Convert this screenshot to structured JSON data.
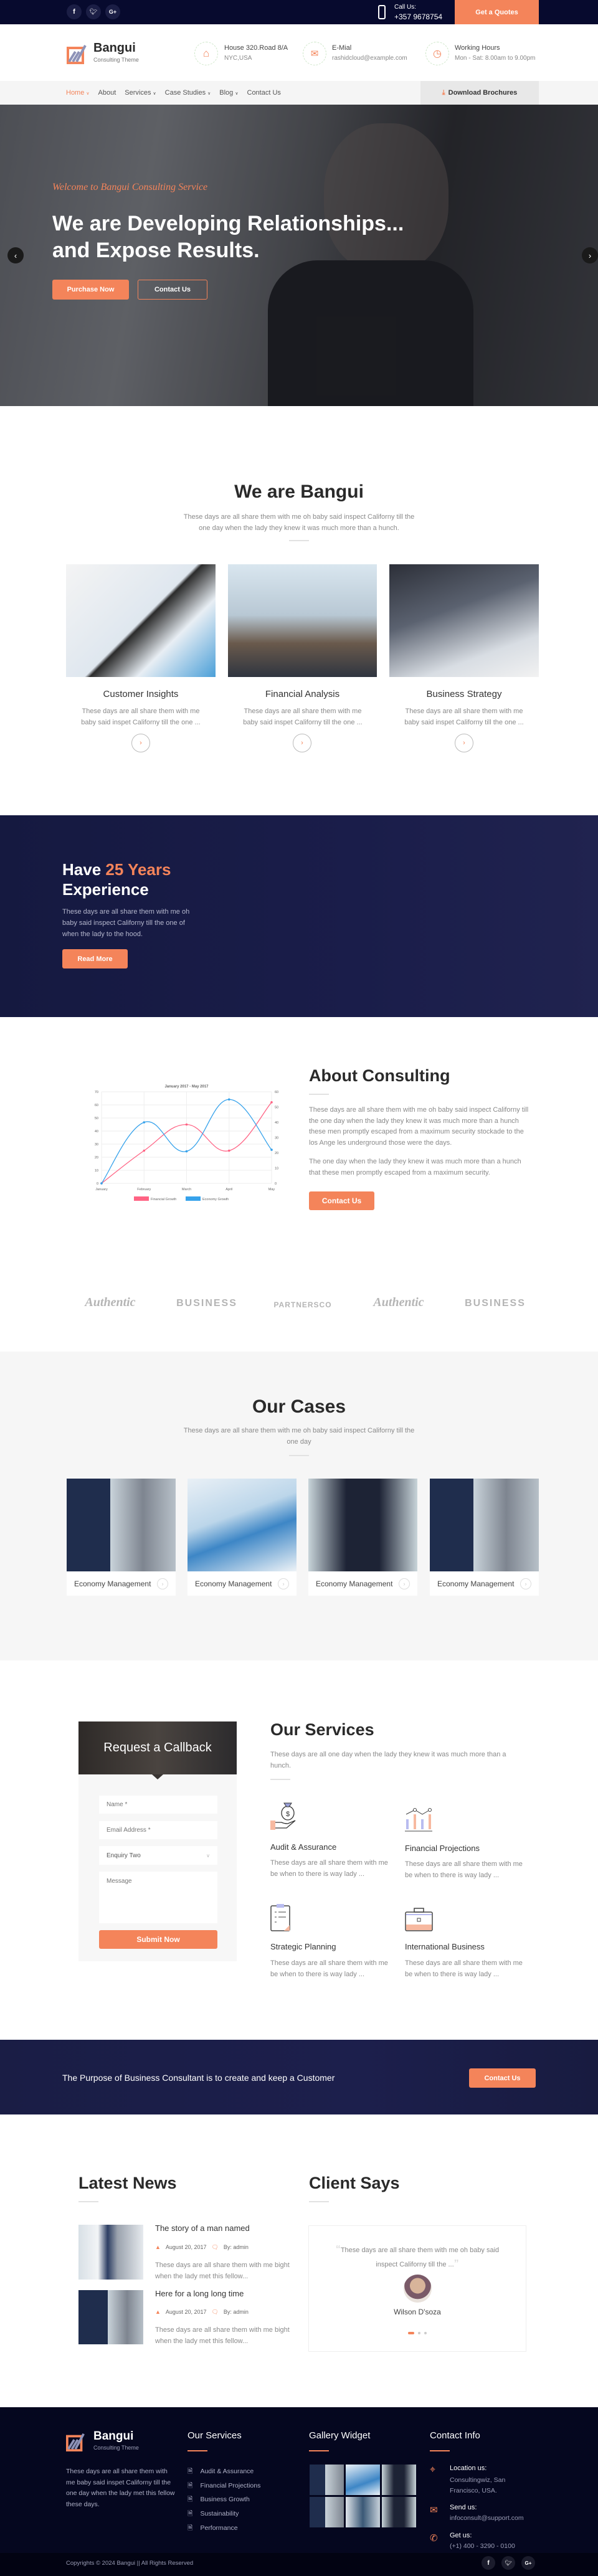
{
  "topbar": {
    "social": [
      "facebook-icon",
      "twitter-icon",
      "google-plus-icon"
    ],
    "call_label": "Call Us:",
    "call_number": "+357 9678754",
    "quote_button": "Get a Quotes"
  },
  "header": {
    "logo_name": "Bangui",
    "logo_tagline": "Consulting Theme",
    "info": [
      {
        "icon": "home-icon",
        "title": "House 320.Road 8/A",
        "text": "NYC,USA"
      },
      {
        "icon": "envelope-icon",
        "title": "E-Mial",
        "text": "rashidcloud@example.com"
      },
      {
        "icon": "clock-icon",
        "title": "Working Hours",
        "text": "Mon - Sat: 8.00am to 9.00pm"
      }
    ]
  },
  "nav": {
    "items": [
      {
        "label": "Home",
        "dropdown": true,
        "active": true
      },
      {
        "label": "About",
        "dropdown": false
      },
      {
        "label": "Services",
        "dropdown": true
      },
      {
        "label": "Case Studies",
        "dropdown": true
      },
      {
        "label": "Blog",
        "dropdown": true
      },
      {
        "label": "Contact Us",
        "dropdown": false
      }
    ],
    "download": "Download Brochures"
  },
  "hero": {
    "welcome": "Welcome to Bangui Consulting Service",
    "line1": "We are Developing Relationships...",
    "line2": "and Expose Results.",
    "purchase": "Purchase Now",
    "contact": "Contact Us"
  },
  "about_bangui": {
    "title": "We are Bangui",
    "subtitle": "These days are all share them with me oh baby said inspect Californy till the one day when the lady they knew it was much more than a hunch.",
    "cards": [
      {
        "title": "Customer Insights",
        "text": "These days are all share them with me baby said inspet Californy till the one ..."
      },
      {
        "title": "Financial Analysis",
        "text": "These days are all share them with me baby said inspet Californy till the one ..."
      },
      {
        "title": "Business Strategy",
        "text": "These days are all share them with me baby said inspet Californy till the one ..."
      }
    ]
  },
  "experience": {
    "have": "Have",
    "years": "25 Years",
    "experience": "Experience",
    "text": "These days are all share them with me oh baby said inspect Californy till the one of when the lady to the hood.",
    "button": "Read More"
  },
  "about_consulting": {
    "title": "About Consulting",
    "para1": "These days are all share them with me oh baby said inspect Californy till the one day when the lady they knew it was much more than a hunch these men promptly escaped from a maximum security stockade to the los Ange les underground those were the days.",
    "para2": "The one day when the lady they knew it was much more than a hunch that these men promptly escaped from a maximum security.",
    "button": "Contact Us"
  },
  "chart_data": {
    "type": "line",
    "title": "January 2017 - May 2017",
    "categories": [
      "January",
      "February",
      "March",
      "April",
      "May"
    ],
    "series": [
      {
        "name": "Financial Growth",
        "values": [
          0,
          25,
          45,
          25,
          62
        ],
        "axis": "left",
        "color": "#ff6384"
      },
      {
        "name": "Economy Growth",
        "values": [
          0,
          40,
          21,
          55,
          22
        ],
        "axis": "right",
        "color": "#36a2eb"
      }
    ],
    "ylim_left": [
      0,
      70
    ],
    "ylim_right": [
      0,
      60
    ],
    "yticks_left": [
      "0",
      "10",
      "20",
      "30",
      "40",
      "50",
      "60",
      "70"
    ],
    "yticks_right": [
      "0",
      "10",
      "20",
      "30",
      "40",
      "50",
      "60"
    ],
    "grid": true,
    "legend": "bottom"
  },
  "partners": [
    {
      "logo": "Authentic"
    },
    {
      "logo": "BUSINESS"
    },
    {
      "logo": "PARTNERSCO"
    },
    {
      "logo": "Authentic"
    },
    {
      "logo": "BUSINESS"
    }
  ],
  "cases": {
    "title": "Our Cases",
    "subtitle": "These days are all share them with me oh baby said inspect Californy till the one day",
    "items": [
      "Economy Management",
      "Economy Management",
      "Economy Management",
      "Economy Management"
    ]
  },
  "callback": {
    "title": "Request a Callback",
    "name_placeholder": "Name *",
    "email_placeholder": "Email Address *",
    "enquiry_value": "Enquiry Two",
    "message_placeholder": "Message",
    "submit": "Submit Now"
  },
  "services": {
    "title": "Our Services",
    "subtitle": "These days are all one day when the lady they knew it was much more than a hunch.",
    "items": [
      {
        "icon": "money-bag-hand-icon",
        "title": "Audit & Assurance",
        "text": "These days are all share them with me be when to there is way lady ..."
      },
      {
        "icon": "bar-chart-icon",
        "title": "Financial Projections",
        "text": "These days are all share them with me be when to there is way lady ..."
      },
      {
        "icon": "clipboard-checklist-icon",
        "title": "Strategic Planning",
        "text": "These days are all share them with me be when to there is way lady ..."
      },
      {
        "icon": "briefcase-icon",
        "title": "International Business",
        "text": "These days are all share them with me be when to there is way lady ..."
      }
    ]
  },
  "cta": {
    "text": "The Purpose of Business Consultant is to create and keep a Customer",
    "button": "Contact Us"
  },
  "news": {
    "title": "Latest News",
    "items": [
      {
        "title": "The story of a man named",
        "date": "August 20, 2017",
        "author": "By: admin",
        "text": "These days are all share them with me bight when the lady met this fellow..."
      },
      {
        "title": "Here for a long long time",
        "date": "August 20, 2017",
        "author": "By: admin",
        "text": "These days are all share them with me bight when the lady met this fellow..."
      }
    ]
  },
  "testimonial": {
    "title": "Client Says",
    "quote": "These days are all share them with me oh baby said inspect Californy till the ...",
    "name": "Wilson D'soza",
    "active_slide": 1,
    "slides": 3
  },
  "footer": {
    "logo_name": "Bangui",
    "logo_tagline": "Consulting Theme",
    "about": "These days are all share them with me baby said inspet Californy till the one day when the lady met this fellow these days.",
    "services_title": "Our Services",
    "services": [
      "Audit & Assurance",
      "Financial Projections",
      "Business Growth",
      "Sustainability",
      "Performance"
    ],
    "gallery_title": "Gallery Widget",
    "contact_title": "Contact Info",
    "contacts": [
      {
        "icon": "location-pin-icon",
        "title": "Location us:",
        "text": "Consultingwiz, San Francisco, USA."
      },
      {
        "icon": "mail-open-icon",
        "title": "Send us:",
        "text": "infoconsult@support.com"
      },
      {
        "icon": "phone-icon",
        "title": "Get us:",
        "text": "(+1) 400 - 3290 - 0100"
      }
    ],
    "copyright": "Copyrights © 2024 Bangui || All Rights Reserved"
  },
  "colors": {
    "accent": "#f4845a",
    "navy": "#070a2e",
    "band": "#1a1d48"
  }
}
